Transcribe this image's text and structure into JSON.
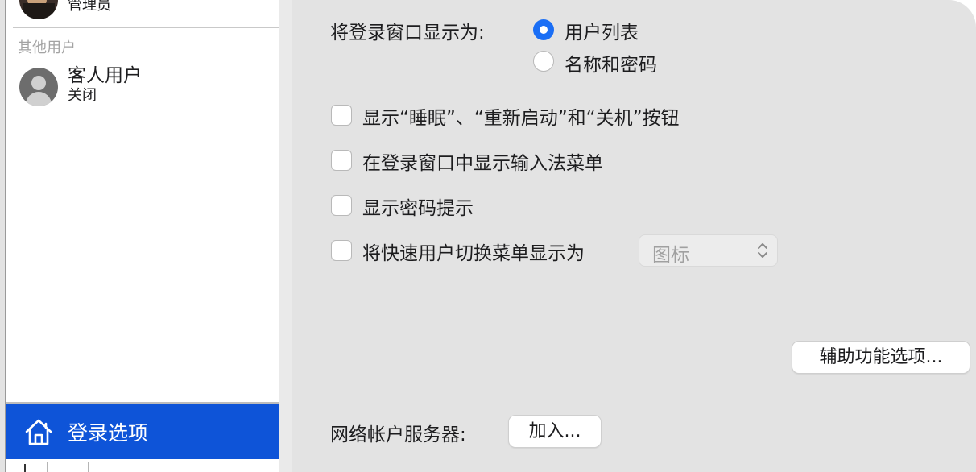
{
  "sidebar": {
    "admin_user": {
      "role": "管理员"
    },
    "other_users_label": "其他用户",
    "guest_user": {
      "name": "客人用户",
      "status": "关闭"
    },
    "login_options_label": "登录选项"
  },
  "main": {
    "display_login_window_label": "将登录窗口显示为:",
    "radio_options": [
      "用户列表",
      "名称和密码"
    ],
    "selected_radio": "用户列表",
    "checkboxes": [
      {
        "label": "显示“睡眠”、“重新启动”和“关机”按钮",
        "checked": false
      },
      {
        "label": "在登录窗口中显示输入法菜单",
        "checked": false
      },
      {
        "label": "显示密码提示",
        "checked": false
      },
      {
        "label": "将快速用户切换菜单显示为",
        "checked": false
      }
    ],
    "fast_switch_popup_value": "图标",
    "accessibility_button": "辅助功能选项...",
    "network_server_label": "网络帐户服务器:",
    "join_button": "加入..."
  },
  "colors": {
    "accent": "#1a6ef5",
    "selection": "#0e54d8",
    "window_bg": "#e3e3e3"
  }
}
